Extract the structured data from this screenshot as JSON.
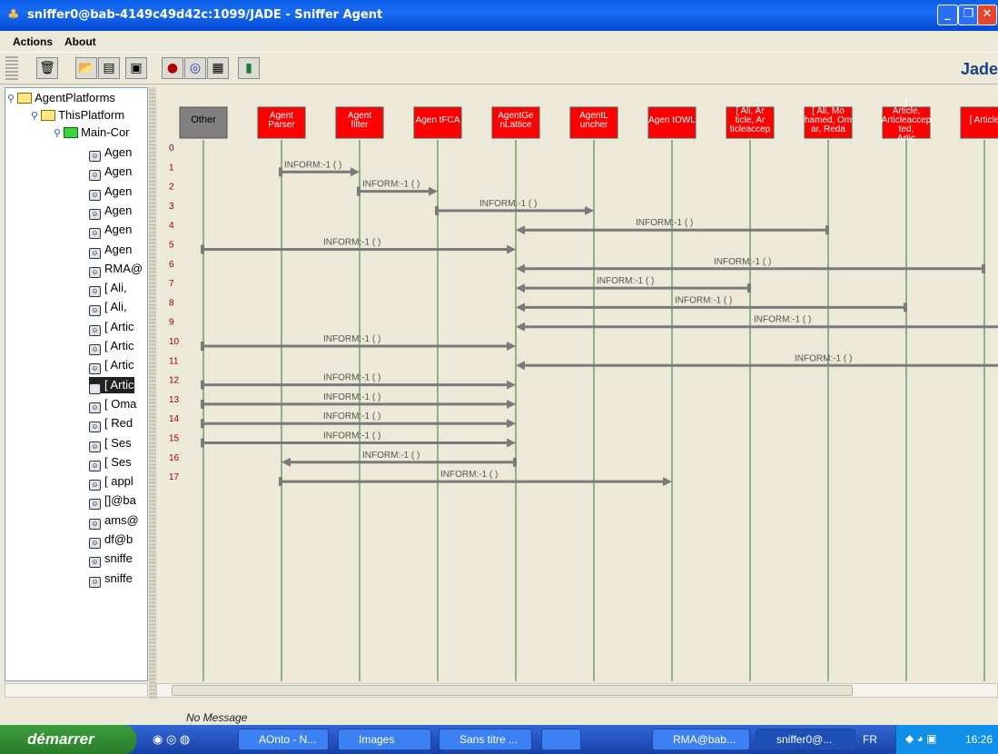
{
  "window": {
    "title": "sniffer0@bab-4149c49d42c:1099/JADE - Sniffer Agent"
  },
  "menu": {
    "actions": "Actions",
    "about": "About"
  },
  "toolbar": {
    "brand": "Jade"
  },
  "tree": {
    "root": "AgentPlatforms",
    "platform": "ThisPlatform",
    "container": "Main-Cor",
    "agents": [
      "Agen",
      "Agen",
      "Agen",
      "Agen",
      "Agen",
      "Agen",
      "RMA@",
      "[ Ali,",
      "[ Ali,",
      "[ Artic",
      "[ Artic",
      "[ Artic",
      "[ Artic",
      "[ Oma",
      "[ Red",
      "[ Ses",
      "[ Ses",
      "[ appl",
      "[]@ba",
      "ams@",
      "df@b",
      "sniffe",
      "sniffe"
    ],
    "selected_index": 12
  },
  "agents": [
    {
      "label": "Other",
      "color": "#808080"
    },
    {
      "label": "Agent Parser",
      "color": "#ff0000"
    },
    {
      "label": "Agent filter",
      "color": "#ff0000"
    },
    {
      "label": "Agen tFCA",
      "color": "#ff0000"
    },
    {
      "label": "AgentGe nLattice",
      "color": "#ff0000"
    },
    {
      "label": "AgentL uncher",
      "color": "#ff0000"
    },
    {
      "label": "Agen tOWL",
      "color": "#ff0000"
    },
    {
      "label": "[ Ali, Ar ticle, Ar ticleaccep",
      "color": "#ff0000"
    },
    {
      "label": "[ Ali, Mo hamed, Om ar, Reda",
      "color": "#ff0000"
    },
    {
      "label": "[ Article, Articleaccep ted, Artic",
      "color": "#ff0000"
    },
    {
      "label": "[ Article",
      "color": "#ff0000"
    }
  ],
  "messages": [
    {
      "n": "0",
      "from": null,
      "to": null,
      "label": ""
    },
    {
      "n": "1",
      "from": 1,
      "to": 2,
      "label": "INFORM:-1 (      )"
    },
    {
      "n": "2",
      "from": 2,
      "to": 3,
      "label": "INFORM:-1 (      )"
    },
    {
      "n": "3",
      "from": 3,
      "to": 5,
      "label": "INFORM:-1 (      )"
    },
    {
      "n": "4",
      "from": 8,
      "to": 4,
      "label": "INFORM:-1 (      )"
    },
    {
      "n": "5",
      "from": 0,
      "to": 4,
      "label": "INFORM:-1 (      )"
    },
    {
      "n": "6",
      "from": 10,
      "to": 4,
      "label": "INFORM:-1 (      )"
    },
    {
      "n": "7",
      "from": 7,
      "to": 4,
      "label": "INFORM:-1 (      )"
    },
    {
      "n": "8",
      "from": 9,
      "to": 4,
      "label": "INFORM:-1 (      )"
    },
    {
      "n": "9",
      "from": 11,
      "to": 4,
      "label": "INFORM:-1 (      )"
    },
    {
      "n": "10",
      "from": 0,
      "to": 4,
      "label": "INFORM:-1 (      )"
    },
    {
      "n": "11",
      "from": 12,
      "to": 4,
      "label": "INFORM:-1 (      )"
    },
    {
      "n": "12",
      "from": 0,
      "to": 4,
      "label": "INFORM:-1 (      )"
    },
    {
      "n": "13",
      "from": 0,
      "to": 4,
      "label": "INFORM:-1 (      )"
    },
    {
      "n": "14",
      "from": 0,
      "to": 4,
      "label": "INFORM:-1 (      )"
    },
    {
      "n": "15",
      "from": 0,
      "to": 4,
      "label": "INFORM:-1 (      )"
    },
    {
      "n": "16",
      "from": 4,
      "to": 1,
      "label": "INFORM:-1 (      )"
    },
    {
      "n": "17",
      "from": 1,
      "to": 6,
      "label": "INFORM:-1 (      )"
    }
  ],
  "status": {
    "text": "No Message"
  },
  "taskbar": {
    "start": "démarrer",
    "buttons": [
      "AOnto - N...",
      "Images",
      "Sans titre ...",
      "",
      "RMA@bab...",
      "sniffer0@..."
    ],
    "lang": "FR",
    "clock": "16:26"
  }
}
